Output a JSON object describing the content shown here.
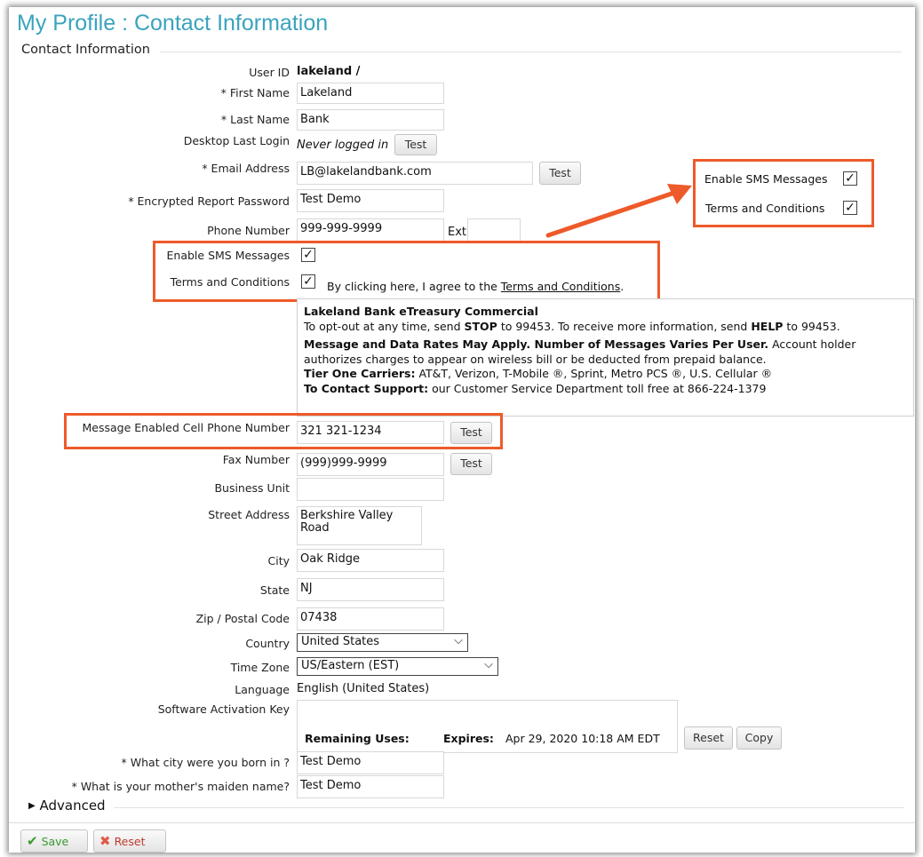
{
  "page": {
    "title": "My Profile : Contact Information",
    "section": "Contact Information"
  },
  "fields": {
    "user_id": {
      "label": "User ID",
      "value": "lakeland /"
    },
    "first_name": {
      "label": "* First Name",
      "value": "Lakeland"
    },
    "last_name": {
      "label": "* Last Name",
      "value": "Bank"
    },
    "desktop_last_login": {
      "label": "Desktop Last Login",
      "value": "Never logged in",
      "button": "Test"
    },
    "email": {
      "label": "* Email Address",
      "value": "LB@lakelandbank.com",
      "button": "Test"
    },
    "report_password": {
      "label": "* Encrypted Report Password",
      "value": "Test Demo"
    },
    "phone": {
      "label": "Phone Number",
      "value": "999-999-9999",
      "ext_label": "Ext",
      "ext_value": ""
    },
    "sms": {
      "label": "Enable SMS Messages",
      "checked": true
    },
    "terms": {
      "label": "Terms and Conditions",
      "checked": true,
      "agree_prefix": "By clicking here, I agree to the",
      "agree_link": "Terms and Conditions",
      "agree_suffix": "."
    },
    "cell_phone": {
      "label": "Message Enabled Cell Phone Number",
      "value": "321 321-1234",
      "button": "Test"
    },
    "fax": {
      "label": "Fax Number",
      "value": "(999)999-9999",
      "button": "Test"
    },
    "business_unit": {
      "label": "Business Unit",
      "value": ""
    },
    "street": {
      "label": "Street Address",
      "value_line1": "Berkshire Valley",
      "value_line2": "Road"
    },
    "city": {
      "label": "City",
      "value": "Oak Ridge"
    },
    "state": {
      "label": "State",
      "value": "NJ"
    },
    "zip": {
      "label": "Zip / Postal Code",
      "value": "07438"
    },
    "country": {
      "label": "Country",
      "value": "United States"
    },
    "timezone": {
      "label": "Time Zone",
      "value": "US/Eastern (EST)"
    },
    "language": {
      "label": "Language",
      "value": "English (United States)"
    },
    "activation_key": {
      "label": "Software Activation Key",
      "remaining_label": "Remaining Uses:",
      "expires_label": "Expires:",
      "expires_value": "Apr 29, 2020 10:18 AM EDT",
      "reset_button": "Reset",
      "copy_button": "Copy"
    },
    "birth_city": {
      "label": "* What city were you born in ?",
      "value": "Test Demo"
    },
    "maiden_name": {
      "label": "* What is your mother's maiden name?",
      "value": "Test Demo"
    }
  },
  "sms_info": {
    "heading": "Lakeland Bank eTreasury Commercial",
    "line1_a": "To opt-out at any time, send ",
    "line1_b": "STOP",
    "line1_c": " to 99453. To receive more information, send ",
    "line1_d": "HELP",
    "line1_e": " to 99453.",
    "rates_bold": "Message and Data Rates May Apply. Number of Messages Varies Per User.",
    "rates_rest": " Account holder authorizes charges to appear on wireless bill or be deducted from prepaid balance.",
    "carriers_bold": "Tier One Carriers:",
    "carriers_rest": " AT&T, Verizon, T-Mobile ®, Sprint, Metro PCS ®, U.S. Cellular ®",
    "support_bold": "To Contact Support:",
    "support_rest": " our Customer Service Department toll free at 866-224-1379"
  },
  "callout": {
    "sms_label": "Enable SMS Messages",
    "terms_label": "Terms and Conditions"
  },
  "advanced": {
    "label": "Advanced"
  },
  "footer": {
    "save": "Save",
    "reset": "Reset"
  },
  "colors": {
    "title": "#3aa3bd",
    "highlight": "#ee5a2a",
    "save_icon": "#3a9a2e",
    "reset_icon": "#e05a4a"
  }
}
